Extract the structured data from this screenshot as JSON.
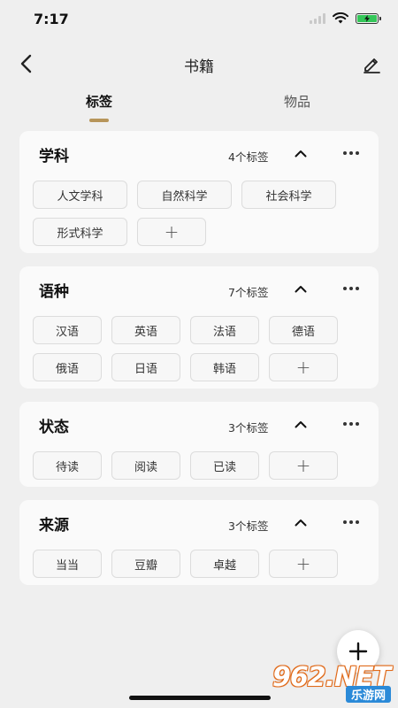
{
  "status_bar": {
    "time": "7:17"
  },
  "nav": {
    "title": "书籍"
  },
  "tabs": [
    {
      "label": "标签"
    },
    {
      "label": "物品"
    }
  ],
  "groups": [
    {
      "title": "学科",
      "count": "4个标签",
      "tags": [
        "人文学科",
        "自然科学",
        "社会科学",
        "形式科学"
      ],
      "add": "+"
    },
    {
      "title": "语种",
      "count": "7个标签",
      "tags": [
        "汉语",
        "英语",
        "法语",
        "德语",
        "俄语",
        "日语",
        "韩语"
      ],
      "add": "+"
    },
    {
      "title": "状态",
      "count": "3个标签",
      "tags": [
        "待读",
        "阅读",
        "已读"
      ],
      "add": "+"
    },
    {
      "title": "来源",
      "count": "3个标签",
      "tags": [
        "当当",
        "豆瓣",
        "卓越"
      ],
      "add": "+"
    }
  ],
  "watermark": {
    "logo": "962.NET",
    "sub": "乐游网"
  },
  "colors": {
    "accent": "#b7955a",
    "background": "#efefef",
    "card": "#fafafa"
  }
}
